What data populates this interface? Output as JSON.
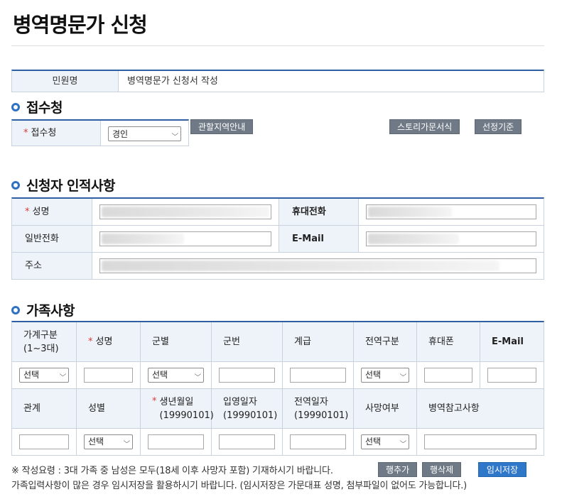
{
  "page_title": "병역명문가 신청",
  "civil": {
    "label": "민원명",
    "value": "병역명문가 신청서 작성"
  },
  "reception": {
    "section_title": "접수청",
    "label": "접수청",
    "selected": "경인",
    "buttons": {
      "region_guide": "관할지역안내",
      "story_form": "스토리가문서식",
      "criteria": "선정기준"
    }
  },
  "applicant": {
    "section_title": "신청자 인적사항",
    "name_label": "성명",
    "mobile_label": "휴대전화",
    "phone_label": "일반전화",
    "email_label": "E-Mail",
    "address_label": "주소"
  },
  "family": {
    "section_title": "가족사항",
    "header1": [
      "가계구분\n(1~3대)",
      "성명",
      "군별",
      "군번",
      "계급",
      "전역구분",
      "휴대폰",
      "E-Mail"
    ],
    "header2": [
      "관계",
      "성별",
      "생년월일\n(19990101)",
      "입영일자\n(19990101)",
      "전역일자\n(19990101)",
      "사망여부",
      "병역참고사항"
    ],
    "select_placeholder": "선택"
  },
  "notes": {
    "line1": "※ 작성요령 : 3대 가족 중 남성은 모두(18세 이후 사망자 포함) 기재하시기 바랍니다.",
    "line2": "가족입력사항이 많은 경우 임시저장을 활용하시기 바랍니다. (임시저장은 가문대표 성명, 첨부파일이 없어도 가능합니다.)"
  },
  "actions": {
    "add_row": "행추가",
    "delete_row": "행삭제",
    "temp_save": "임시저장"
  }
}
